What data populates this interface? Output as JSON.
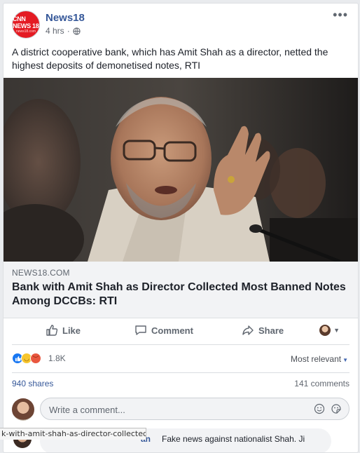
{
  "post": {
    "page_name": "News18",
    "avatar_text": "CNN NEWS 18",
    "avatar_sub": "news18.com",
    "time": "4 hrs",
    "time_sep": "·",
    "text": "A district cooperative bank, which has Amit Shah as a director, netted the highest deposits of demonetised notes, RTI"
  },
  "link": {
    "domain": "NEWS18.COM",
    "title": "Bank with Amit Shah as Director Collected Most Banned Notes Among DCCBs: RTI"
  },
  "actions": {
    "like": "Like",
    "comment": "Comment",
    "share": "Share"
  },
  "reactions": {
    "count": "1.8K",
    "sort_label": "Most relevant",
    "icons": [
      "like-icon",
      "haha-icon",
      "angry-icon"
    ]
  },
  "stats": {
    "shares": "940 shares",
    "comments": "141 comments"
  },
  "composer": {
    "placeholder": "Write a comment..."
  },
  "comment": {
    "author_fragment": "an",
    "text": "Fake news against nationalist Shah. Ji"
  },
  "status_bar": {
    "url": "k-with-amit-shah-as-director-collected"
  },
  "colors": {
    "link_blue": "#365899",
    "like_blue": "#1877f2",
    "brand_red": "#e41b23"
  }
}
